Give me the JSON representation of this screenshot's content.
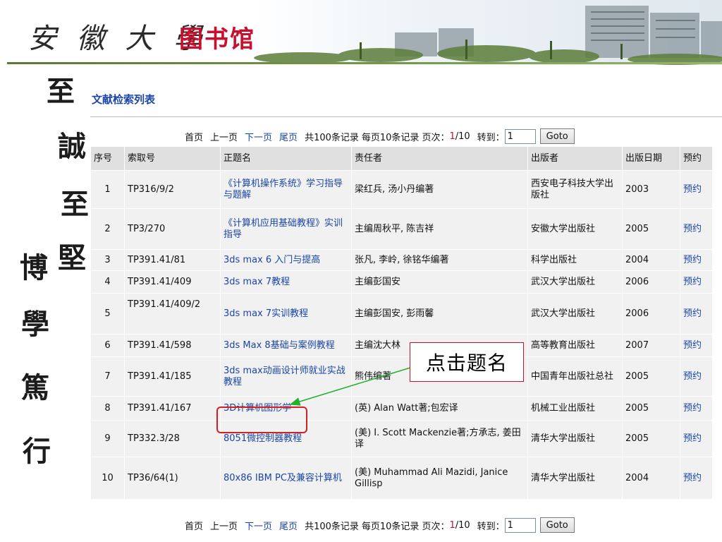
{
  "banner": {
    "calligraphy": "安 徽 大 學",
    "library": "图书馆"
  },
  "motto": [
    "至",
    "誠",
    "至",
    "堅",
    "博",
    "學",
    "篤",
    "行"
  ],
  "page_title": "文献检索列表",
  "pager": {
    "first": "首页",
    "prev": "上一页",
    "next": "下一页",
    "last": "尾页",
    "total_prefix": "共100条记录",
    "per_page": "每页10条记录",
    "page_label": "页次：",
    "page_current": "1",
    "page_total": "/10",
    "goto_label": "转到：",
    "goto_value": "1",
    "goto_button": "Goto"
  },
  "table": {
    "headers": [
      "序号",
      "索取号",
      "正题名",
      "责任者",
      "出版者",
      "出版日期",
      "预约"
    ],
    "rows": [
      {
        "seq": "1",
        "call_no": "TP316/9/2",
        "title": "《计算机操作系统》学习指导与题解",
        "author": "梁红兵, 汤小丹编著",
        "publisher": "西安电子科技大学出版社",
        "year": "2003",
        "reserve": "预约"
      },
      {
        "seq": "2",
        "call_no": "TP3/270",
        "title": "《计算机应用基础教程》实训指导",
        "author": "主编周秋平, 陈吉祥",
        "publisher": "安徽大学出版社",
        "year": "2005",
        "reserve": "预约"
      },
      {
        "seq": "3",
        "call_no": "TP391.41/81",
        "title": "3ds max 6 入门与提高",
        "author": "张凡, 李岭, 徐铭华编著",
        "publisher": "科学出版社",
        "year": "2004",
        "reserve": "预约"
      },
      {
        "seq": "4",
        "call_no": "TP391.41/409",
        "title": "3ds max 7教程",
        "author": "主编彭国安",
        "publisher": "武汉大学出版社",
        "year": "2006",
        "reserve": "预约"
      },
      {
        "seq": "5",
        "call_no": "TP391.41/409/2",
        "title": "3ds max 7实训教程",
        "author": "主编彭国安, 彭雨馨",
        "publisher": "武汉大学出版社",
        "year": "2006",
        "reserve": "预约"
      },
      {
        "seq": "6",
        "call_no": "TP391.41/598",
        "title": "3ds Max 8基础与案例教程",
        "author": "主编沈大林",
        "publisher": "高等教育出版社",
        "year": "2007",
        "reserve": "预约"
      },
      {
        "seq": "7",
        "call_no": "TP391.41/185",
        "title": "3ds max动画设计师就业实战教程",
        "author": "熊伟编著",
        "publisher": "中国青年出版社总社",
        "year": "2005",
        "reserve": "预约"
      },
      {
        "seq": "8",
        "call_no": "TP391.41/167",
        "title": "3D计算机图形学",
        "author": "(英) Alan Watt著;包宏译",
        "publisher": "机械工业出版社",
        "year": "2005",
        "reserve": "预约"
      },
      {
        "seq": "9",
        "call_no": "TP332.3/28",
        "title": "8051微控制器教程",
        "author": "(美) I. Scott Mackenzie著;方承志, 姜田译",
        "publisher": "清华大学出版社",
        "year": "2005",
        "reserve": "预约"
      },
      {
        "seq": "10",
        "call_no": "TP36/64(1)",
        "title": "80x86 IBM PC及兼容计算机",
        "author": "(美) Muhammad Ali Mazidi, Janice Gillisp",
        "publisher": "清华大学出版社",
        "year": "2004",
        "reserve": "预约"
      }
    ]
  },
  "annotation": {
    "text": "点击题名",
    "color": "#c8102e",
    "arrow_color": "#22b02e"
  }
}
